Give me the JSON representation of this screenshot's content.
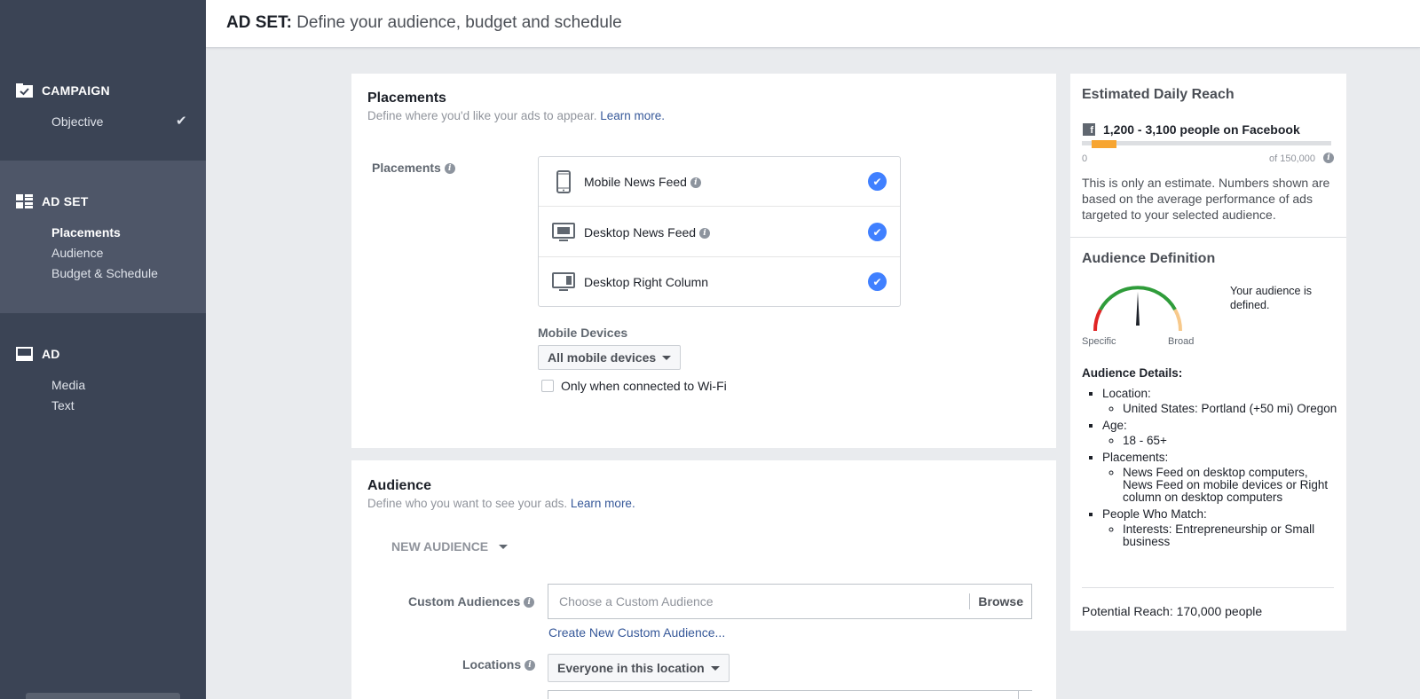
{
  "header": {
    "prefix": "AD SET:",
    "title": "Define your audience, budget and schedule"
  },
  "sidebar": {
    "campaign": {
      "label": "CAMPAIGN",
      "items": [
        {
          "label": "Objective",
          "done": true
        }
      ]
    },
    "adset": {
      "label": "AD SET",
      "items": [
        {
          "label": "Placements",
          "current": true
        },
        {
          "label": "Audience"
        },
        {
          "label": "Budget & Schedule"
        }
      ]
    },
    "ad": {
      "label": "AD",
      "items": [
        {
          "label": "Media"
        },
        {
          "label": "Text"
        }
      ]
    }
  },
  "placements": {
    "title": "Placements",
    "subtitle": "Define where you'd like your ads to appear.",
    "learn_more": "Learn more.",
    "field_label": "Placements",
    "options": [
      {
        "label": "Mobile News Feed",
        "checked": true,
        "icon": "mobile-phone-icon"
      },
      {
        "label": "Desktop News Feed",
        "checked": true,
        "icon": "desktop-monitor-icon"
      },
      {
        "label": "Desktop Right Column",
        "checked": true,
        "icon": "desktop-right-column-icon"
      }
    ],
    "mobile_devices_label": "Mobile Devices",
    "mobile_devices_value": "All mobile devices",
    "wifi_label": "Only when connected to Wi-Fi",
    "wifi_checked": false
  },
  "audience": {
    "title": "Audience",
    "subtitle": "Define who you want to see your ads.",
    "learn_more": "Learn more.",
    "new_audience": "NEW AUDIENCE",
    "custom_label": "Custom Audiences",
    "custom_placeholder": "Choose a Custom Audience",
    "browse": "Browse",
    "create_link": "Create New Custom Audience...",
    "locations_label": "Locations",
    "locations_value": "Everyone in this location"
  },
  "reach": {
    "title": "Estimated Daily Reach",
    "range": "1,200 - 3,100 people on Facebook",
    "min": "0",
    "max": "of 150,000",
    "note": "This is only an estimate. Numbers shown are based on the average performance of ads targeted to your selected audience."
  },
  "definition": {
    "title": "Audience Definition",
    "status": "Your audience is defined.",
    "specific": "Specific",
    "broad": "Broad",
    "details_title": "Audience Details:",
    "location_label": "Location:",
    "location_value": "United States: Portland (+50 mi) Oregon",
    "age_label": "Age:",
    "age_value": "18 - 65+",
    "placements_label": "Placements:",
    "placements_value": "News Feed on desktop computers, News Feed on mobile devices or Right column on desktop computers",
    "match_label": "People Who Match:",
    "match_value": "Interests: Entrepreneurship or Small business",
    "potential": "Potential Reach: 170,000 people"
  },
  "colors": {
    "sidebar": "#3b4455",
    "accent": "#4080ff",
    "link": "#365899",
    "reach": "#f7a531"
  }
}
